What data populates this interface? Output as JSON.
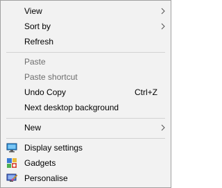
{
  "context_menu": {
    "view": {
      "label": "View",
      "icon": "chevron-right-icon"
    },
    "sort_by": {
      "label": "Sort by",
      "icon": "chevron-right-icon"
    },
    "refresh": {
      "label": "Refresh"
    },
    "paste": {
      "label": "Paste",
      "enabled": false
    },
    "paste_shortcut": {
      "label": "Paste shortcut",
      "enabled": false
    },
    "undo_copy": {
      "label": "Undo Copy",
      "shortcut": "Ctrl+Z"
    },
    "next_background": {
      "label": "Next desktop background"
    },
    "new": {
      "label": "New",
      "icon": "chevron-right-icon"
    },
    "display_settings": {
      "label": "Display settings",
      "icon": "display-settings-icon"
    },
    "gadgets": {
      "label": "Gadgets",
      "icon": "gadgets-icon"
    },
    "personalise": {
      "label": "Personalise",
      "icon": "personalise-icon"
    }
  },
  "colors": {
    "menu_background": "#f2f2f2",
    "menu_border": "#a0a0a0",
    "disabled_text": "#6d6d6d",
    "separator": "#d2d2d2"
  }
}
